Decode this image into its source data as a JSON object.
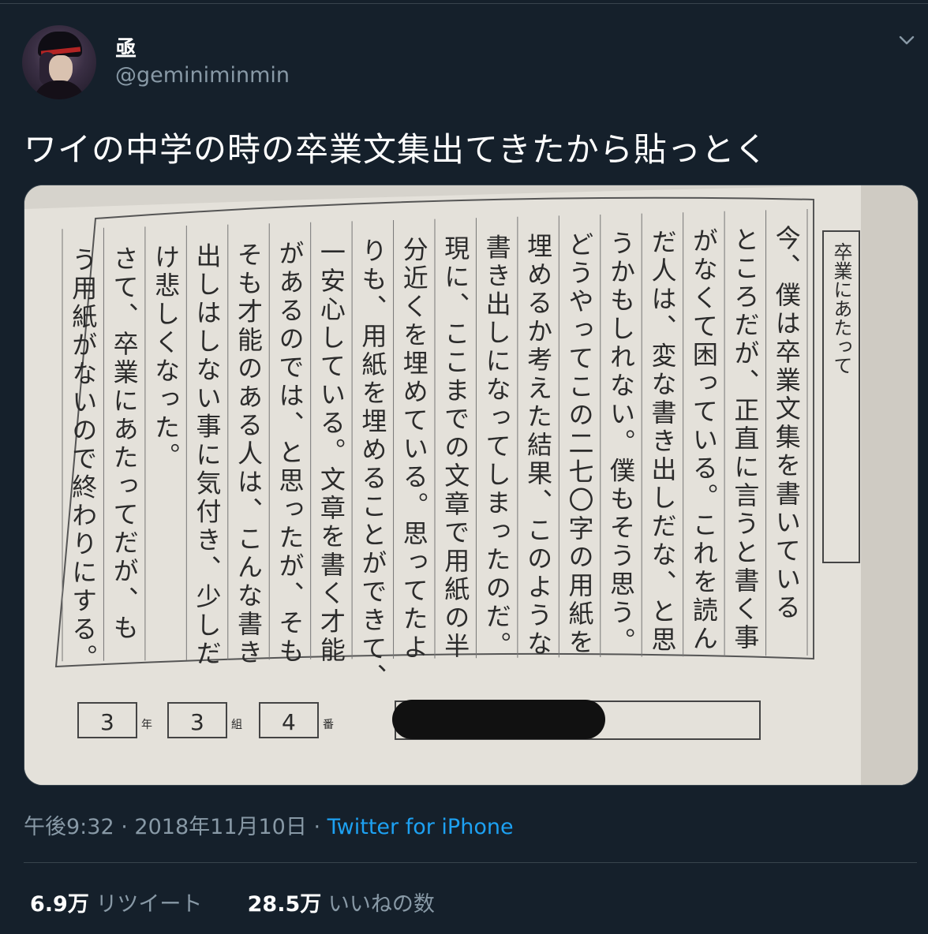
{
  "user": {
    "display_name": "亟",
    "handle": "@geminiminmin",
    "avatar_icon": "anime-character-avatar"
  },
  "menu_icon": "chevron-down-icon",
  "tweet": {
    "text": "ワイの中学の時の卒業文集出てきたから貼っとく"
  },
  "media": {
    "title": "卒業にあたって",
    "columns": [
      "今、僕は卒業文集を書いている",
      "ところだが、正直に言うと書く事",
      "がなくて困っている。これを読ん",
      "だ人は、変な書き出しだな、と思",
      "うかもしれない。僕もそう思う。",
      "どうやってこの二七〇字の用紙を",
      "埋めるか考えた結果、このような",
      "書き出しになってしまったのだ。",
      "現に、ここまでの文章で用紙の半",
      "分近くを埋めている。思ってたよ",
      "りも、用紙を埋めることができて、",
      "一安心している。文章を書く才能",
      "があるのでは、と思ったが、そも",
      "そも才能のある人は、こんな書き",
      "出しはしない事に気付き、少しだ",
      "け悲しくなった。",
      "さて、卒業にあたってだが、も",
      "う用紙がないので終わりにする。"
    ],
    "grade": "3",
    "grade_label": "年",
    "class": "3",
    "class_label": "組",
    "number": "4",
    "number_label": "番"
  },
  "meta": {
    "time": "午後9:32",
    "separator": "·",
    "date": "2018年11月10日",
    "source": "Twitter for iPhone"
  },
  "stats": {
    "retweets": "6.9万",
    "retweets_label": "リツイート",
    "likes": "28.5万",
    "likes_label": "いいねの数"
  },
  "colors": {
    "background": "#15202b",
    "secondary_text": "#8899a6",
    "link": "#1da1f2",
    "divider": "#38444d"
  }
}
